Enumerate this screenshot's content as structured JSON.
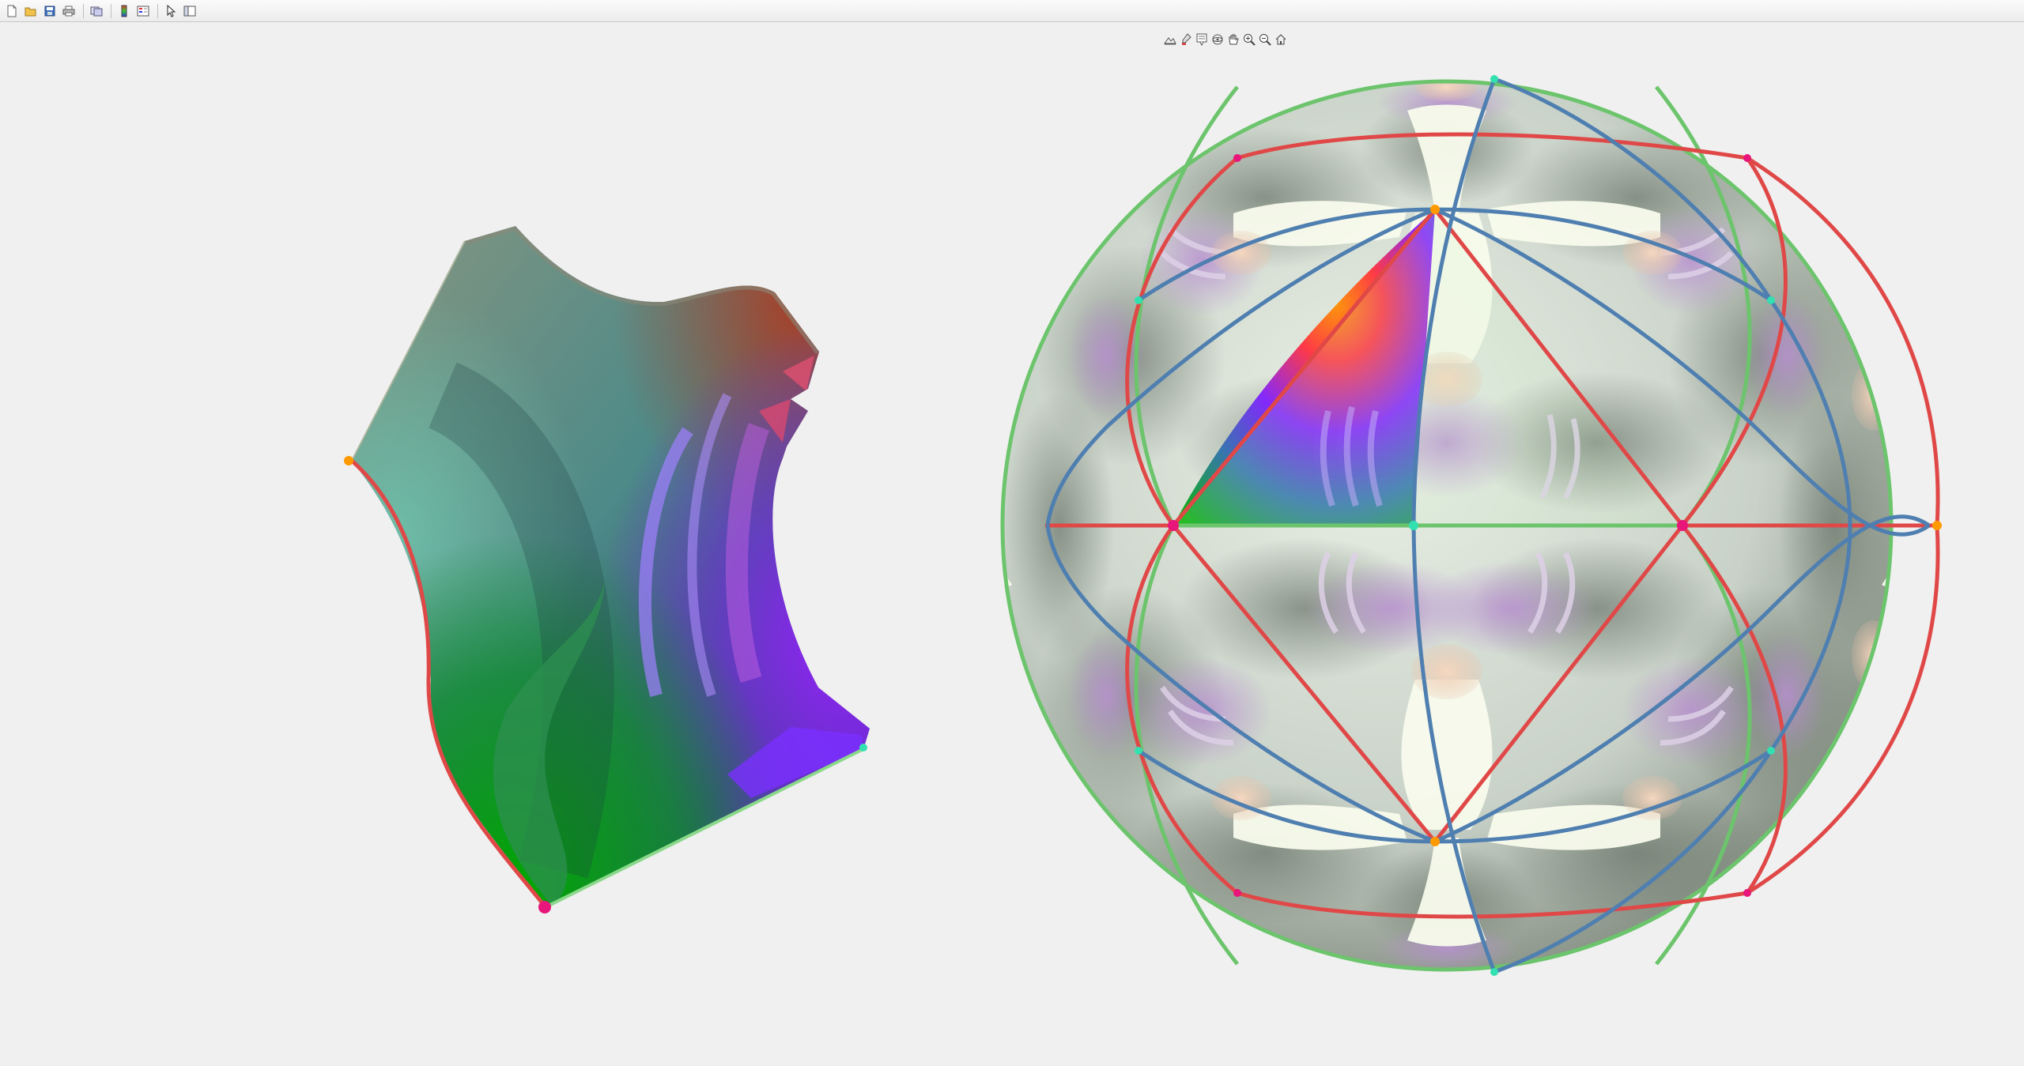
{
  "figure_toolbar": {
    "buttons": [
      {
        "id": "new",
        "icon": "new-figure-icon"
      },
      {
        "id": "open",
        "icon": "open-file-icon"
      },
      {
        "id": "save",
        "icon": "save-figure-icon"
      },
      {
        "id": "print",
        "icon": "print-figure-icon"
      },
      {
        "id": "link",
        "icon": "link-plot-icon"
      },
      {
        "id": "colorbar",
        "icon": "insert-colorbar-icon"
      },
      {
        "id": "legend",
        "icon": "insert-legend-icon"
      },
      {
        "id": "edit",
        "icon": "edit-plot-pointer-icon"
      },
      {
        "id": "property",
        "icon": "property-inspector-icon"
      }
    ]
  },
  "axes_toolbar": {
    "buttons": [
      {
        "id": "export",
        "icon": "export-icon"
      },
      {
        "id": "brush",
        "icon": "brush-data-icon"
      },
      {
        "id": "datatip",
        "icon": "data-tips-icon"
      },
      {
        "id": "rotate",
        "icon": "rotate-3d-icon"
      },
      {
        "id": "pan",
        "icon": "pan-hand-icon"
      },
      {
        "id": "zoomin",
        "icon": "zoom-in-icon"
      },
      {
        "id": "zoomout",
        "icon": "zoom-out-icon"
      },
      {
        "id": "home",
        "icon": "restore-view-home-icon"
      }
    ]
  },
  "colors": {
    "red_edge": "#e04848",
    "green_edge": "#6cc46c",
    "blue_edge": "#4f7fb0",
    "vertex_magenta": "#e8157a",
    "vertex_orange": "#ff9900",
    "vertex_cyan": "#33e0b0",
    "background": "#f0f0f0"
  }
}
